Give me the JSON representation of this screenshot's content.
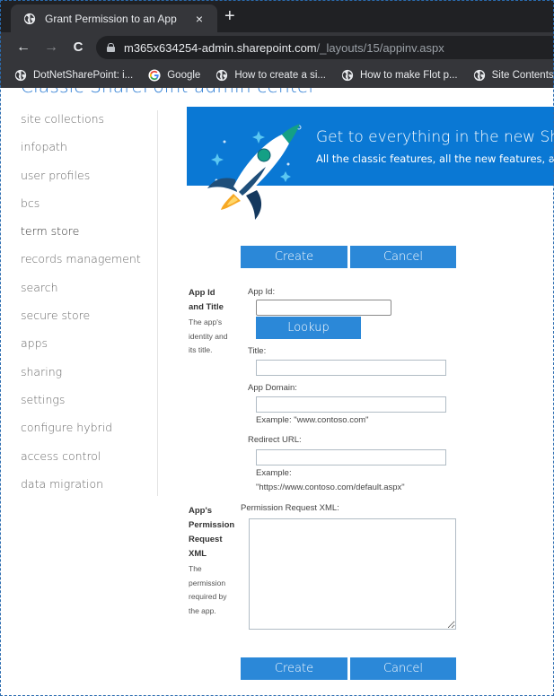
{
  "browser": {
    "tab_title": "Grant Permission to an App",
    "tab_close": "×",
    "new_tab": "+",
    "back": "←",
    "forward": "→",
    "reload": "C",
    "url_host": "m365x634254-admin.sharepoint.com",
    "url_path": "/_layouts/15/appinv.aspx",
    "bookmarks": [
      {
        "label": "DotNetSharePoint: i...",
        "icon": "globe-icon"
      },
      {
        "label": "Google",
        "icon": "google-icon"
      },
      {
        "label": "How to create a si...",
        "icon": "globe-icon"
      },
      {
        "label": "How to make Flot p...",
        "icon": "globe-icon"
      },
      {
        "label": "Site Contents",
        "icon": "globe-icon"
      }
    ]
  },
  "site_title": "Classic SharePoint admin center",
  "sidebar": {
    "items": [
      {
        "label": "site collections"
      },
      {
        "label": "infopath"
      },
      {
        "label": "user profiles"
      },
      {
        "label": "bcs"
      },
      {
        "label": "term store",
        "active": true
      },
      {
        "label": "records management"
      },
      {
        "label": "search"
      },
      {
        "label": "secure store"
      },
      {
        "label": "apps"
      },
      {
        "label": "sharing"
      },
      {
        "label": "settings"
      },
      {
        "label": "configure hybrid"
      },
      {
        "label": "access control"
      },
      {
        "label": "data migration"
      }
    ]
  },
  "banner": {
    "headline": "Get to everything in the new SharePoint admin center",
    "subtext": "All the classic features, all the new features, and a modern look",
    "colors": {
      "background": "#0a78d4"
    }
  },
  "form": {
    "create_label": "Create",
    "cancel_label": "Cancel",
    "lookup_label": "Lookup",
    "section_app": {
      "title_line1": "App Id",
      "title_line2": "and Title",
      "desc_line1": "The app's",
      "desc_line2": "identity and",
      "desc_line3": "its title."
    },
    "app_id": {
      "label": "App Id:",
      "value": ""
    },
    "title": {
      "label": "Title:",
      "value": ""
    },
    "app_domain": {
      "label": "App Domain:",
      "value": "",
      "example": "Example: \"www.contoso.com\""
    },
    "redirect_url": {
      "label": "Redirect URL:",
      "value": "",
      "example_line1": "Example:",
      "example_line2": "\"https://www.contoso.com/default.aspx\""
    },
    "section_xml": {
      "title_line1": "App's",
      "title_line2": "Permission",
      "title_line3": "Request",
      "title_line4": "XML",
      "desc_line1": "The",
      "desc_line2": "permission",
      "desc_line3": "required by",
      "desc_line4": "the app."
    },
    "permission_xml": {
      "label": "Permission Request XML:",
      "value": ""
    },
    "button_color": "#2b88d8"
  }
}
